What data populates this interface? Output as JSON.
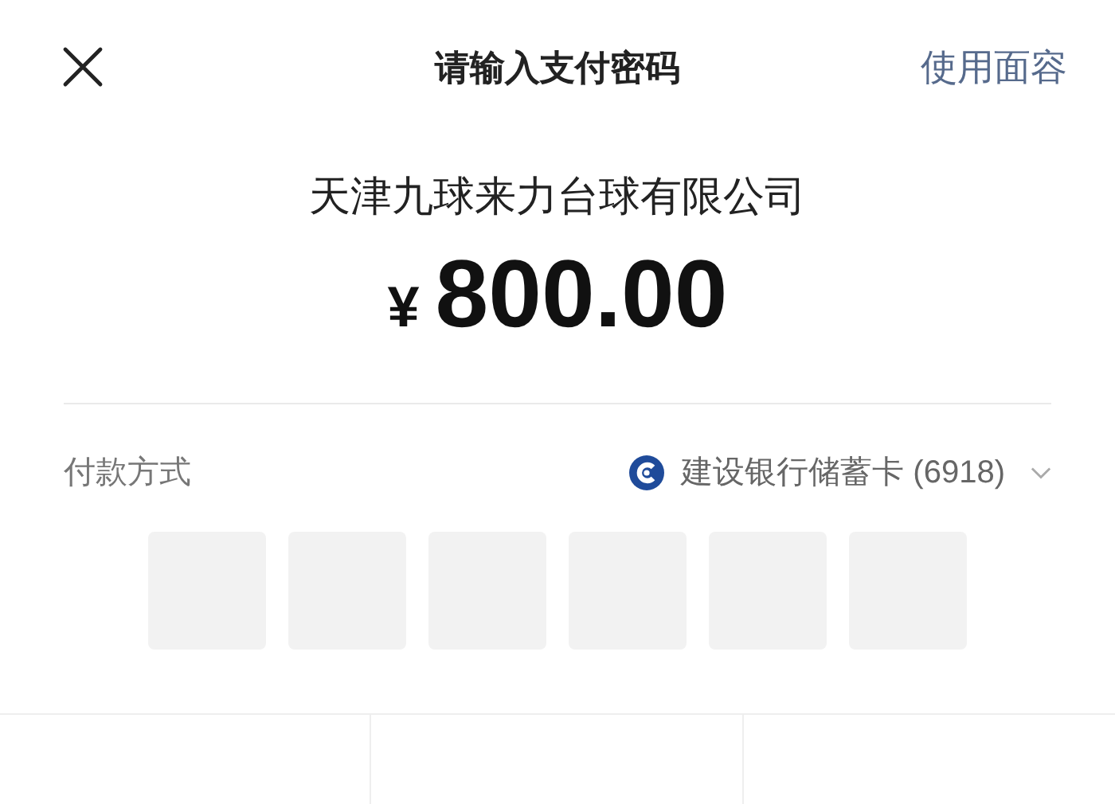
{
  "header": {
    "title": "请输入支付密码",
    "face_link": "使用面容"
  },
  "merchant": "天津九球来力台球有限公司",
  "amount": {
    "currency": "¥",
    "value": "800.00"
  },
  "payment": {
    "label": "付款方式",
    "card": "建设银行储蓄卡 (6918)"
  },
  "pin_boxes": [
    {
      "filled": false
    },
    {
      "filled": false
    },
    {
      "filled": false
    },
    {
      "filled": false
    },
    {
      "filled": false
    },
    {
      "filled": false
    }
  ]
}
